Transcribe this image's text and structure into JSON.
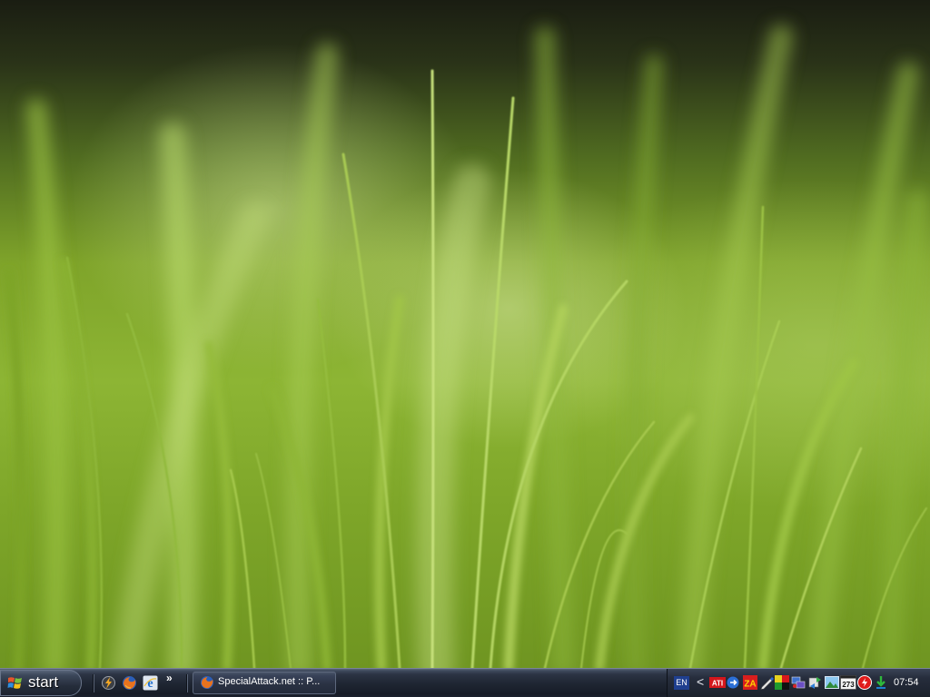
{
  "desktop": {
    "wallpaper": "green-grass-closeup"
  },
  "taskbar": {
    "start_label": "start",
    "quick_launch": {
      "items": [
        {
          "icon": "winamp-lightning-icon"
        },
        {
          "icon": "firefox-icon"
        },
        {
          "icon": "internet-explorer-icon"
        }
      ],
      "more_label": "»"
    },
    "tasks": [
      {
        "label": "SpecialAttack.net :: P...",
        "icon": "firefox-icon"
      }
    ],
    "tray": {
      "language": "EN",
      "expand_label": "<",
      "icons": [
        {
          "icon": "ati-icon",
          "text": "ATI"
        },
        {
          "icon": "network-arrow-icon"
        },
        {
          "icon": "zonealarm-icon",
          "text": "ZA"
        },
        {
          "icon": "pen-tool-icon"
        },
        {
          "icon": "color-squares-icon"
        },
        {
          "icon": "network-computers-icon"
        },
        {
          "icon": "sync-icon"
        },
        {
          "icon": "picture-icon"
        },
        {
          "icon": "calendar-icon",
          "text": "273"
        },
        {
          "icon": "flash-shield-icon"
        },
        {
          "icon": "download-arrow-icon"
        }
      ],
      "clock": "07:54"
    }
  },
  "colors": {
    "taskbar": "#1f2633",
    "wallpaper_green": "#8db534",
    "wallpaper_dark": "#1a1d12"
  }
}
